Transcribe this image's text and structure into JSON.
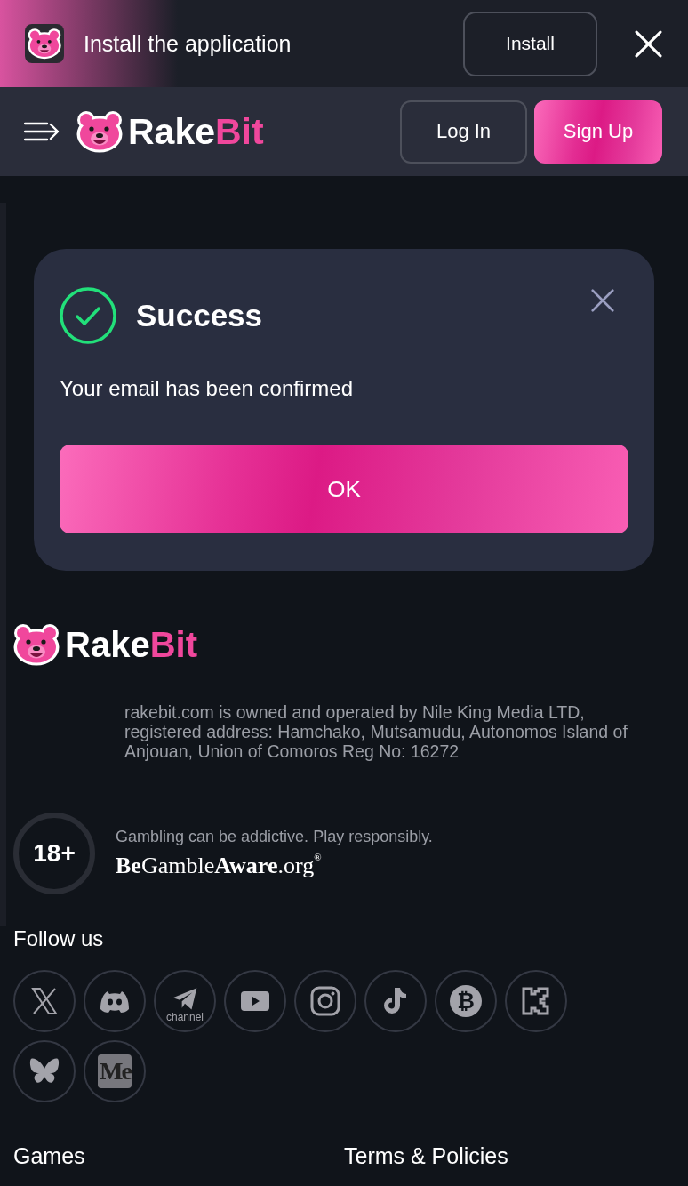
{
  "install_banner": {
    "title": "Install the application",
    "install_button": "Install"
  },
  "header": {
    "logo": {
      "text": "Rake",
      "accent": "Bit"
    },
    "login_button": "Log In",
    "signup_button": "Sign Up"
  },
  "dialog": {
    "title": "Success",
    "message": "Your email has been confirmed",
    "ok_button": "OK"
  },
  "footer": {
    "logo": {
      "text": "Rake",
      "accent": "Bit"
    },
    "legal_text": "rakebit.com is owned and operated by Nile King Media LTD, registered address: Hamchako, Mutsamudu, Autonomos Island of Anjouan, Union of Comoros Reg No: 16272",
    "age_badge": "18+",
    "gambling_notice": "Gambling can be addictive. Play responsibly.",
    "gamble_aware": "**Be**Gamble**Aware**.org$^{®}$"
  },
  "follow_us": {
    "title": "Follow us",
    "links": [
      {
        "kind": "x"
      },
      {
        "kind": "discord"
      },
      {
        "kind": "telegram",
        "caption": "channel"
      },
      {
        "kind": "youtube"
      },
      {
        "kind": "instagram"
      },
      {
        "kind": "tiktok"
      },
      {
        "kind": "coin",
        "glyph": "₿"
      },
      {
        "kind": "kick"
      },
      {
        "kind": "butterfly"
      },
      {
        "kind": "tile",
        "text": "Me"
      }
    ]
  },
  "footer_sections": [
    "Games",
    "Terms & Policies"
  ]
}
